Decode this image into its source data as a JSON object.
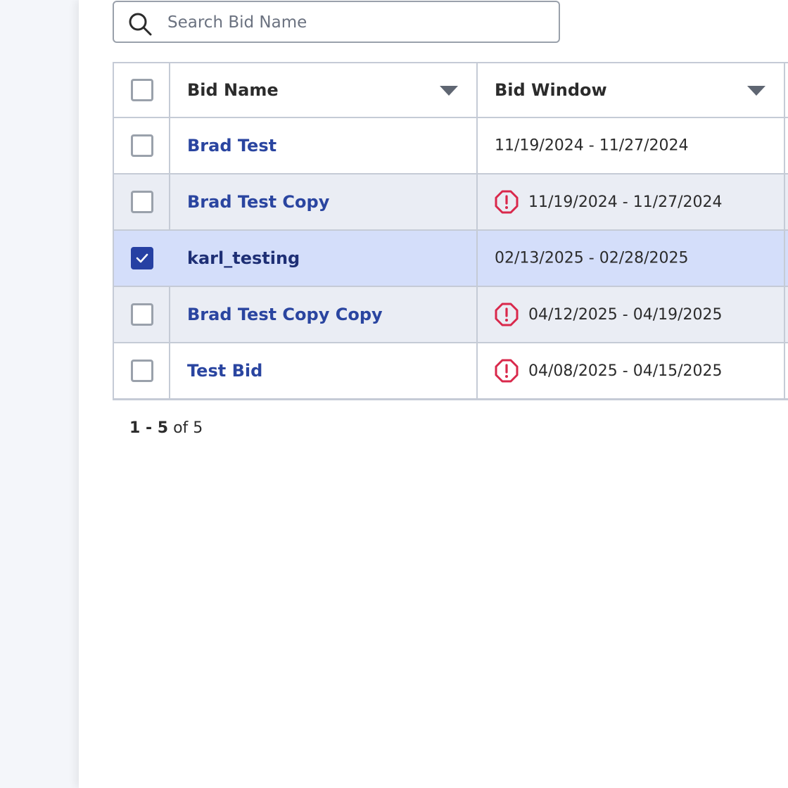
{
  "search": {
    "placeholder": "Search Bid Name",
    "value": ""
  },
  "table": {
    "columns": [
      {
        "label": "Bid Name"
      },
      {
        "label": "Bid Window"
      }
    ],
    "rows": [
      {
        "name": "Brad Test",
        "window": "11/19/2024 - 11/27/2024",
        "warning": false,
        "selected": false
      },
      {
        "name": "Brad Test Copy",
        "window": "11/19/2024 - 11/27/2024",
        "warning": true,
        "selected": false
      },
      {
        "name": "karl_testing",
        "window": "02/13/2025 - 02/28/2025",
        "warning": false,
        "selected": true
      },
      {
        "name": "Brad Test Copy Copy",
        "window": "04/12/2025 - 04/19/2025",
        "warning": true,
        "selected": false
      },
      {
        "name": "Test Bid",
        "window": "04/08/2025 - 04/15/2025",
        "warning": true,
        "selected": false
      }
    ]
  },
  "pagination": {
    "range": "1 - 5",
    "of_label": "of",
    "total": "5"
  },
  "colors": {
    "accent": "#2640a3",
    "link": "#2a45a0",
    "warning": "#d9284b",
    "selected_row": "#d4defa",
    "alt_row": "#eaedf4"
  },
  "icons": {
    "search": "search-icon",
    "sort": "caret-down-icon",
    "warning": "octagon-alert-icon",
    "check": "checkmark-icon"
  }
}
